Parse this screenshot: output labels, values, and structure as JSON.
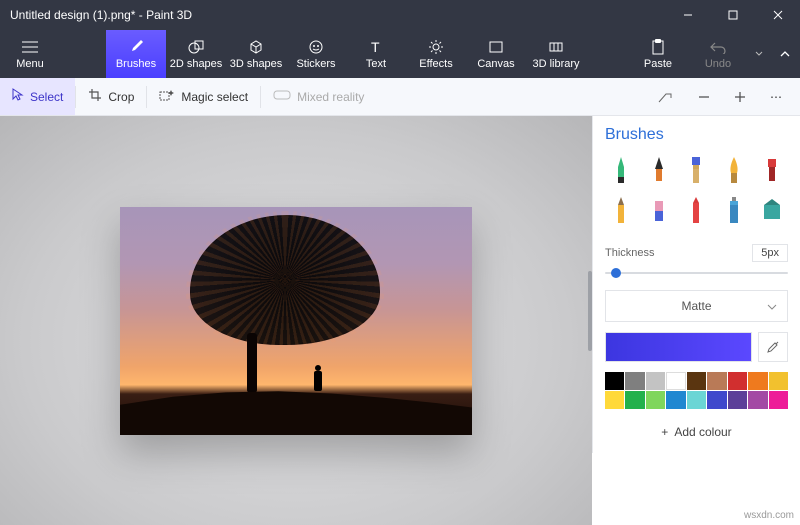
{
  "window": {
    "title": "Untitled design (1).png* - Paint 3D"
  },
  "ribbon": {
    "menu": "Menu",
    "items": [
      {
        "label": "Brushes",
        "icon": "brush-icon",
        "active": true
      },
      {
        "label": "2D shapes",
        "icon": "shape2d-icon"
      },
      {
        "label": "3D shapes",
        "icon": "shape3d-icon"
      },
      {
        "label": "Stickers",
        "icon": "sticker-icon"
      },
      {
        "label": "Text",
        "icon": "text-icon"
      },
      {
        "label": "Effects",
        "icon": "effects-icon"
      },
      {
        "label": "Canvas",
        "icon": "canvas-icon"
      },
      {
        "label": "3D library",
        "icon": "library-icon"
      }
    ],
    "paste": "Paste",
    "undo": "Undo"
  },
  "toolbar": {
    "select": "Select",
    "crop": "Crop",
    "magic_select": "Magic select",
    "mixed_reality": "Mixed reality"
  },
  "panel": {
    "heading": "Brushes",
    "thickness_label": "Thickness",
    "thickness_value": "5px",
    "finish": "Matte",
    "current_color": "#4a3fff",
    "swatches": [
      "#000000",
      "#7f7f7f",
      "#c3c3c3",
      "#ffffff",
      "#5a3510",
      "#b97a57",
      "#d12f2f",
      "#ef7a1e",
      "#f2c12e",
      "#ffd93a",
      "#22b14c",
      "#7fd65c",
      "#1f87d1",
      "#6bd5d5",
      "#3f48cc",
      "#5c3f99",
      "#a349a4",
      "#ed1c98"
    ],
    "add_colour": "Add colour"
  },
  "watermark": "wsxdn.com"
}
